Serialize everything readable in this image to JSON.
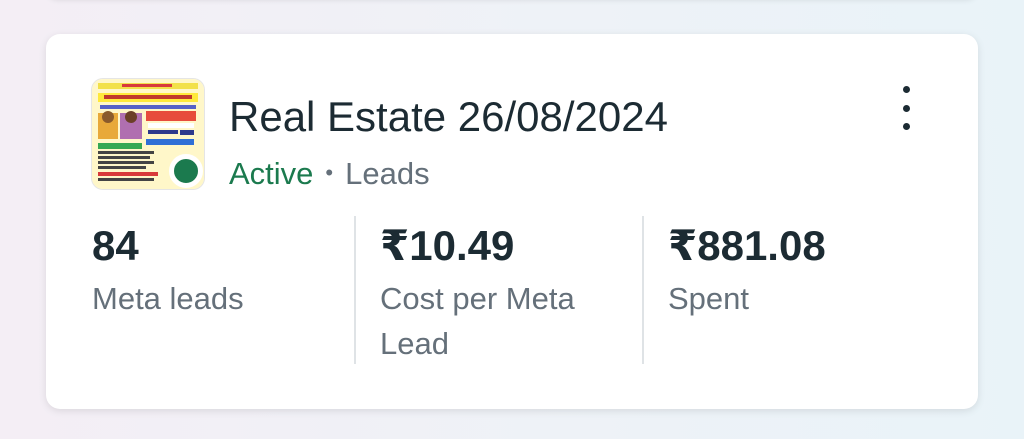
{
  "campaign": {
    "title": "Real Estate 26/08/2024",
    "status": "Active",
    "objective": "Leads",
    "separator": "•",
    "thumbnail_icon": "ad-creative-thumbnail",
    "status_color": "#1b7a4e"
  },
  "metrics": [
    {
      "value": "84",
      "label": "Meta leads"
    },
    {
      "value": "₹10.49",
      "label": "Cost per Meta Lead"
    },
    {
      "value": "₹881.08",
      "label": "Spent"
    }
  ],
  "icons": {
    "more": "more-options-icon"
  }
}
